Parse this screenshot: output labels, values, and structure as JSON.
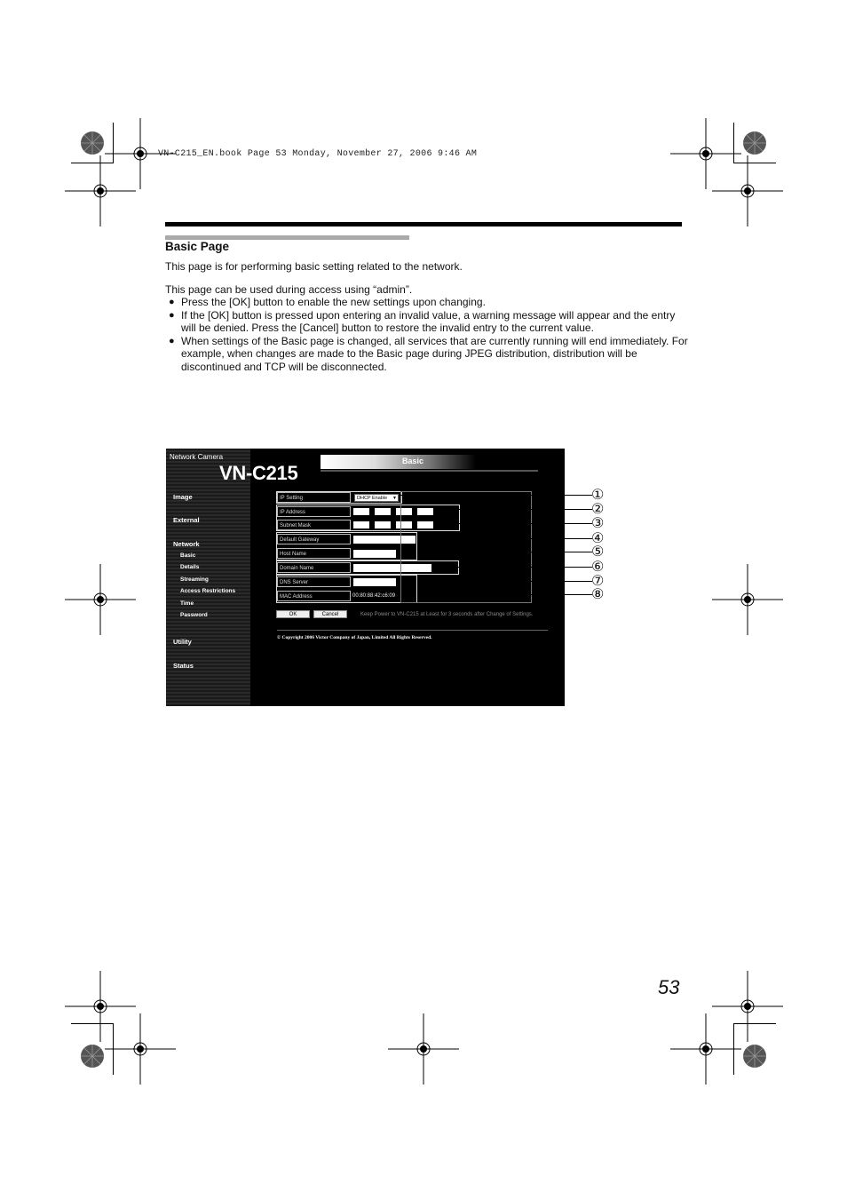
{
  "print_header": "VN-C215_EN.book  Page 53  Monday, November 27, 2006  9:46 AM",
  "section": {
    "title": "Basic Page",
    "intro": "This page is for performing basic setting related to the network.",
    "access_note": "This page can be used during access using “admin”.",
    "bullets": [
      "Press the [OK] button to enable the new settings upon changing.",
      "If the [OK] button is pressed upon entering an invalid value, a warning message will appear and the entry will be denied. Press the [Cancel] button to restore the invalid entry to the current value.",
      "When settings of the Basic page is changed, all services that are currently running will end immediately. For example, when changes are made to the Basic page during JPEG distribution, distribution will be discontinued and TCP will be disconnected."
    ],
    "bullet_symbol": "●"
  },
  "screenshot": {
    "brand_small": "Network Camera",
    "brand_big": "VN-C215",
    "tab": "Basic",
    "nav": {
      "image": "Image",
      "external": "External",
      "network": "Network",
      "basic": "Basic",
      "details": "Details",
      "streaming": "Streaming",
      "access": "Access Restrictions",
      "time": "Time",
      "password": "Password",
      "utility": "Utility",
      "status": "Status"
    },
    "fields": {
      "ip_setting": {
        "label": "IP Setting",
        "value": "DHCP Enable"
      },
      "ip_address": {
        "label": "IP Address"
      },
      "subnet_mask": {
        "label": "Subnet Mask"
      },
      "gateway": {
        "label": "Default Gateway"
      },
      "host_name": {
        "label": "Host Name"
      },
      "domain_name": {
        "label": "Domain Name"
      },
      "dns_server": {
        "label": "DNS Server"
      },
      "mac_address": {
        "label": "MAC Address",
        "value": "00:80:88:42:c6:09"
      }
    },
    "ok_label": "OK",
    "cancel_label": "Cancel",
    "notice": "Keep Power to VN-C215 at Least for 3 seconds after Change of Settings.",
    "copyright": "© Copyright 2006 Victor Company of Japan, Limited All Rights Reserved."
  },
  "callouts": [
    "①",
    "②",
    "③",
    "④",
    "⑤",
    "⑥",
    "⑦",
    "⑧"
  ],
  "page_number": "53"
}
